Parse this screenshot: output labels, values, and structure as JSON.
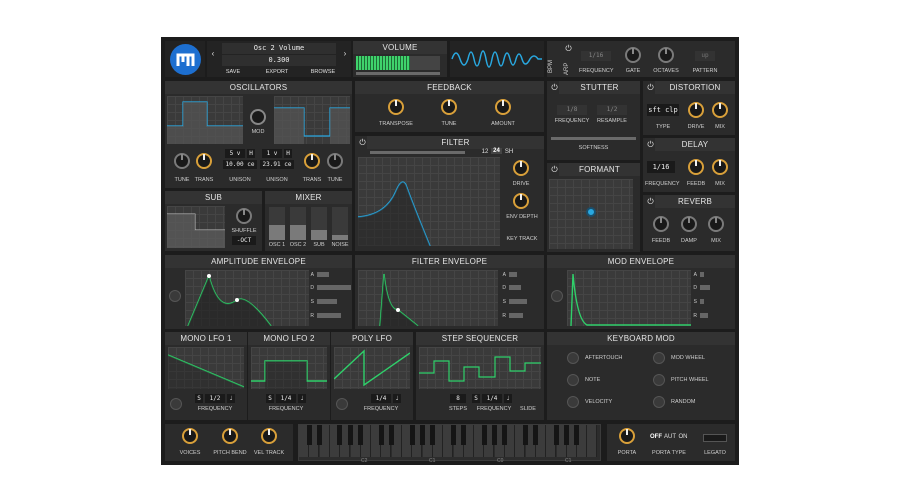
{
  "preset": {
    "name": "Osc 2 Volume",
    "value": "0.300",
    "save": "SAVE",
    "export": "EXPORT",
    "browse": "BROWSE"
  },
  "volume": {
    "title": "VOLUME"
  },
  "bpm": {
    "label": "BPM"
  },
  "arp": {
    "label": "ARP",
    "rate": "1/16",
    "knobs": [
      "FREQUENCY",
      "GATE",
      "OCTAVES",
      "PATTERN"
    ],
    "pattern": "up"
  },
  "oscillators": {
    "title": "OSCILLATORS",
    "mod": "MOD",
    "osc1": {
      "unison_voices": "5 v",
      "unison_detune": "10.00 ce"
    },
    "osc2": {
      "unison_voices": "1 v",
      "unison_detune": "23.91 ce"
    },
    "h": "H",
    "tune": "TUNE",
    "trans": "TRANS",
    "unison": "UNISON"
  },
  "feedback": {
    "title": "FEEDBACK",
    "knobs": [
      "TRANSPOSE",
      "TUNE",
      "AMOUNT"
    ]
  },
  "stutter": {
    "title": "STUTTER",
    "freq_val": "1/8",
    "resample_val": "1/2",
    "frequency": "FREQUENCY",
    "resample": "RESAMPLE",
    "softness": "SOFTNESS"
  },
  "distortion": {
    "title": "DISTORTION",
    "type": "sft clp",
    "labels": [
      "TYPE",
      "DRIVE",
      "MIX"
    ]
  },
  "filter": {
    "title": "FILTER",
    "modes": [
      "12",
      "24",
      "SH"
    ],
    "drive": "DRIVE",
    "env_depth": "ENV DEPTH",
    "key_track": "KEY TRACK"
  },
  "delay": {
    "title": "DELAY",
    "rate": "1/16",
    "labels": [
      "FREQUENCY",
      "FEEDB",
      "MIX"
    ]
  },
  "formant": {
    "title": "FORMANT"
  },
  "reverb": {
    "title": "REVERB",
    "labels": [
      "FEEDB",
      "DAMP",
      "MIX"
    ]
  },
  "sub": {
    "title": "SUB",
    "shuffle": "SHUFFLE",
    "oct": "-OCT"
  },
  "mixer": {
    "title": "MIXER",
    "channels": [
      "OSC 1",
      "OSC 2",
      "SUB",
      "NOISE"
    ],
    "levels": [
      0.45,
      0.45,
      0.3,
      0.15
    ]
  },
  "envelopes": [
    {
      "title": "AMPLITUDE ENVELOPE"
    },
    {
      "title": "FILTER ENVELOPE"
    },
    {
      "title": "MOD ENVELOPE"
    }
  ],
  "adsr": [
    "A",
    "D",
    "S",
    "R"
  ],
  "lfos": [
    {
      "title": "MONO LFO 1",
      "rate": "1/2",
      "freq": "FREQUENCY"
    },
    {
      "title": "MONO LFO 2",
      "rate": "1/4",
      "freq": "FREQUENCY"
    },
    {
      "title": "POLY LFO",
      "rate": "1/4",
      "freq": "FREQUENCY"
    }
  ],
  "step_sequencer": {
    "title": "STEP SEQUENCER",
    "steps_val": "8",
    "rate": "1/4",
    "steps": "STEPS",
    "frequency": "FREQUENCY",
    "slide": "SLIDE"
  },
  "keyboard_mod": {
    "title": "KEYBOARD MOD",
    "items": [
      "AFTERTOUCH",
      "MOD WHEEL",
      "NOTE",
      "PITCH WHEEL",
      "VELOCITY",
      "RANDOM"
    ]
  },
  "bottom": {
    "voices": "VOICES",
    "pitch_bend": "PITCH BEND",
    "vel_track": "VEL TRACK",
    "porta": "PORTA",
    "porta_type": "PORTA TYPE",
    "porta_opts": [
      "OFF",
      "AUT",
      "ON"
    ],
    "legato": "LEGATO",
    "octaves": [
      "C2",
      "C1",
      "C0",
      "C1",
      "C2"
    ]
  },
  "colors": {
    "accent": "#29a8e0",
    "env_green": "#2fd06a",
    "knob_ring": "#d9a03a"
  }
}
